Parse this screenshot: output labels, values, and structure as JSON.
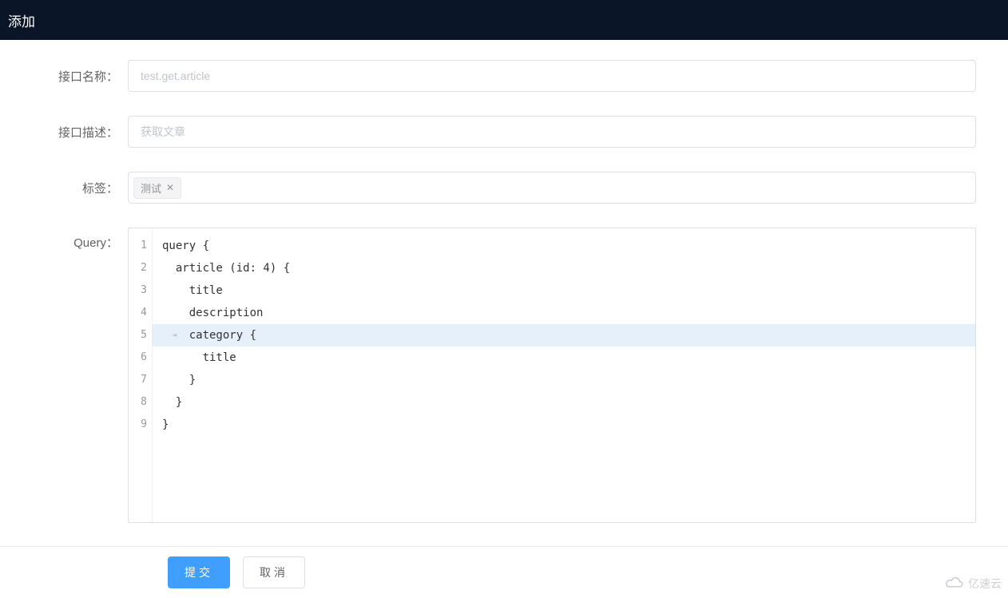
{
  "header": {
    "title": "添加"
  },
  "form": {
    "name": {
      "label": "接口名称：",
      "placeholder": "test.get.article",
      "value": ""
    },
    "description": {
      "label": "接口描述：",
      "placeholder": "获取文章",
      "value": ""
    },
    "tags": {
      "label": "标签：",
      "items": [
        "测试"
      ]
    },
    "query": {
      "label": "Query：",
      "active_line": 5,
      "lines": [
        "query {",
        "  article (id: 4) {",
        "    title",
        "    description",
        "    category {",
        "      title",
        "    }",
        "  }",
        "}"
      ]
    }
  },
  "footer": {
    "submit": "提交",
    "cancel": "取消"
  },
  "watermark": {
    "text": "亿速云"
  }
}
